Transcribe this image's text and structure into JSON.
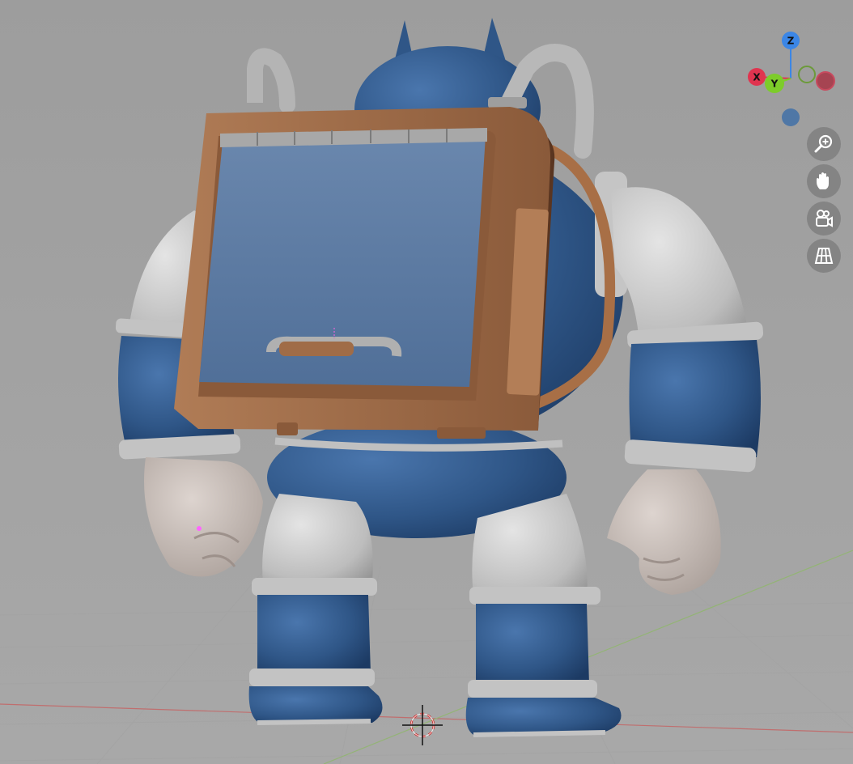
{
  "viewport": {
    "background_color": "#aaaaaa",
    "grid_color": "#a2a2a2",
    "x_axis_color": "#c46a6a",
    "y_axis_color": "#8fb070"
  },
  "gizmo": {
    "x_label": "X",
    "y_label": "Y",
    "z_label": "Z",
    "x_color": "#e0344f",
    "y_color": "#7dcc2a",
    "z_color": "#3b86e6"
  },
  "nav_buttons": [
    {
      "name": "zoom-button",
      "icon": "magnifier-plus-icon"
    },
    {
      "name": "pan-button",
      "icon": "hand-icon"
    },
    {
      "name": "camera-view-button",
      "icon": "camera-icon"
    },
    {
      "name": "perspective-toggle-button",
      "icon": "grid-icon"
    }
  ],
  "model": {
    "body_color": "#355f93",
    "joint_color": "#bcbcbc",
    "leather_color": "#a06c47",
    "backpack_panel_color": "#5c7ca6",
    "skin_color": "#c8beb8"
  }
}
